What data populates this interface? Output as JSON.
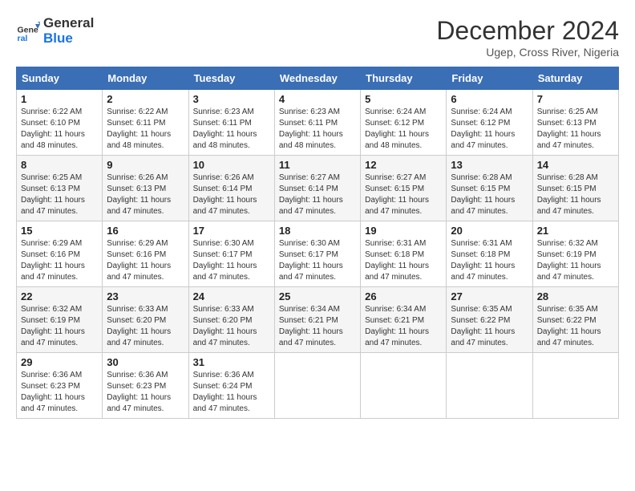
{
  "logo": {
    "line1": "General",
    "line2": "Blue"
  },
  "title": "December 2024",
  "subtitle": "Ugep, Cross River, Nigeria",
  "days_header": [
    "Sunday",
    "Monday",
    "Tuesday",
    "Wednesday",
    "Thursday",
    "Friday",
    "Saturday"
  ],
  "weeks": [
    [
      {
        "day": "1",
        "info": "Sunrise: 6:22 AM\nSunset: 6:10 PM\nDaylight: 11 hours\nand 48 minutes."
      },
      {
        "day": "2",
        "info": "Sunrise: 6:22 AM\nSunset: 6:11 PM\nDaylight: 11 hours\nand 48 minutes."
      },
      {
        "day": "3",
        "info": "Sunrise: 6:23 AM\nSunset: 6:11 PM\nDaylight: 11 hours\nand 48 minutes."
      },
      {
        "day": "4",
        "info": "Sunrise: 6:23 AM\nSunset: 6:11 PM\nDaylight: 11 hours\nand 48 minutes."
      },
      {
        "day": "5",
        "info": "Sunrise: 6:24 AM\nSunset: 6:12 PM\nDaylight: 11 hours\nand 48 minutes."
      },
      {
        "day": "6",
        "info": "Sunrise: 6:24 AM\nSunset: 6:12 PM\nDaylight: 11 hours\nand 47 minutes."
      },
      {
        "day": "7",
        "info": "Sunrise: 6:25 AM\nSunset: 6:13 PM\nDaylight: 11 hours\nand 47 minutes."
      }
    ],
    [
      {
        "day": "8",
        "info": "Sunrise: 6:25 AM\nSunset: 6:13 PM\nDaylight: 11 hours\nand 47 minutes."
      },
      {
        "day": "9",
        "info": "Sunrise: 6:26 AM\nSunset: 6:13 PM\nDaylight: 11 hours\nand 47 minutes."
      },
      {
        "day": "10",
        "info": "Sunrise: 6:26 AM\nSunset: 6:14 PM\nDaylight: 11 hours\nand 47 minutes."
      },
      {
        "day": "11",
        "info": "Sunrise: 6:27 AM\nSunset: 6:14 PM\nDaylight: 11 hours\nand 47 minutes."
      },
      {
        "day": "12",
        "info": "Sunrise: 6:27 AM\nSunset: 6:15 PM\nDaylight: 11 hours\nand 47 minutes."
      },
      {
        "day": "13",
        "info": "Sunrise: 6:28 AM\nSunset: 6:15 PM\nDaylight: 11 hours\nand 47 minutes."
      },
      {
        "day": "14",
        "info": "Sunrise: 6:28 AM\nSunset: 6:15 PM\nDaylight: 11 hours\nand 47 minutes."
      }
    ],
    [
      {
        "day": "15",
        "info": "Sunrise: 6:29 AM\nSunset: 6:16 PM\nDaylight: 11 hours\nand 47 minutes."
      },
      {
        "day": "16",
        "info": "Sunrise: 6:29 AM\nSunset: 6:16 PM\nDaylight: 11 hours\nand 47 minutes."
      },
      {
        "day": "17",
        "info": "Sunrise: 6:30 AM\nSunset: 6:17 PM\nDaylight: 11 hours\nand 47 minutes."
      },
      {
        "day": "18",
        "info": "Sunrise: 6:30 AM\nSunset: 6:17 PM\nDaylight: 11 hours\nand 47 minutes."
      },
      {
        "day": "19",
        "info": "Sunrise: 6:31 AM\nSunset: 6:18 PM\nDaylight: 11 hours\nand 47 minutes."
      },
      {
        "day": "20",
        "info": "Sunrise: 6:31 AM\nSunset: 6:18 PM\nDaylight: 11 hours\nand 47 minutes."
      },
      {
        "day": "21",
        "info": "Sunrise: 6:32 AM\nSunset: 6:19 PM\nDaylight: 11 hours\nand 47 minutes."
      }
    ],
    [
      {
        "day": "22",
        "info": "Sunrise: 6:32 AM\nSunset: 6:19 PM\nDaylight: 11 hours\nand 47 minutes."
      },
      {
        "day": "23",
        "info": "Sunrise: 6:33 AM\nSunset: 6:20 PM\nDaylight: 11 hours\nand 47 minutes."
      },
      {
        "day": "24",
        "info": "Sunrise: 6:33 AM\nSunset: 6:20 PM\nDaylight: 11 hours\nand 47 minutes."
      },
      {
        "day": "25",
        "info": "Sunrise: 6:34 AM\nSunset: 6:21 PM\nDaylight: 11 hours\nand 47 minutes."
      },
      {
        "day": "26",
        "info": "Sunrise: 6:34 AM\nSunset: 6:21 PM\nDaylight: 11 hours\nand 47 minutes."
      },
      {
        "day": "27",
        "info": "Sunrise: 6:35 AM\nSunset: 6:22 PM\nDaylight: 11 hours\nand 47 minutes."
      },
      {
        "day": "28",
        "info": "Sunrise: 6:35 AM\nSunset: 6:22 PM\nDaylight: 11 hours\nand 47 minutes."
      }
    ],
    [
      {
        "day": "29",
        "info": "Sunrise: 6:36 AM\nSunset: 6:23 PM\nDaylight: 11 hours\nand 47 minutes."
      },
      {
        "day": "30",
        "info": "Sunrise: 6:36 AM\nSunset: 6:23 PM\nDaylight: 11 hours\nand 47 minutes."
      },
      {
        "day": "31",
        "info": "Sunrise: 6:36 AM\nSunset: 6:24 PM\nDaylight: 11 hours\nand 47 minutes."
      },
      {
        "day": "",
        "info": ""
      },
      {
        "day": "",
        "info": ""
      },
      {
        "day": "",
        "info": ""
      },
      {
        "day": "",
        "info": ""
      }
    ]
  ]
}
